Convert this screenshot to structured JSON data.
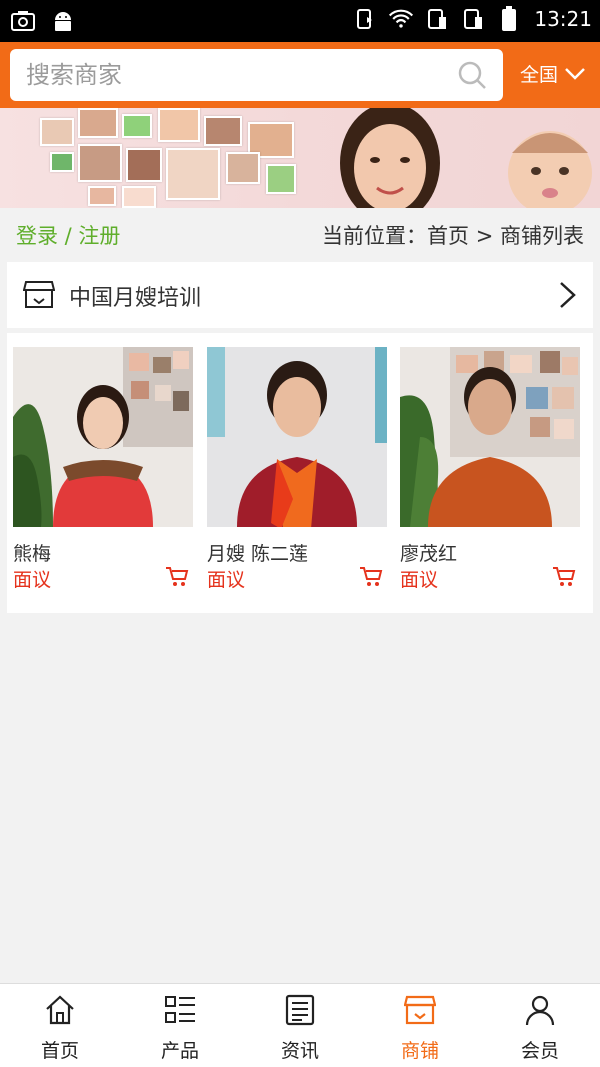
{
  "status_bar": {
    "time": "13:21"
  },
  "search": {
    "placeholder": "搜索商家",
    "region": "全国"
  },
  "breadcrumb": {
    "login": "登录 / 注册",
    "path": "当前位置：首页 > 商铺列表"
  },
  "shop": {
    "name": "中国月嫂培训"
  },
  "products": [
    {
      "name": "熊梅",
      "price": "面议"
    },
    {
      "name": "月嫂 陈二莲",
      "price": "面议"
    },
    {
      "name": "廖茂红",
      "price": "面议"
    }
  ],
  "tabs": [
    {
      "label": "首页",
      "icon": "home-icon"
    },
    {
      "label": "产品",
      "icon": "list-icon"
    },
    {
      "label": "资讯",
      "icon": "news-icon"
    },
    {
      "label": "商铺",
      "icon": "store-icon",
      "active": true
    },
    {
      "label": "会员",
      "icon": "user-icon"
    }
  ],
  "colors": {
    "accent": "#f26b17",
    "price": "#e5321c",
    "login": "#5fae2b"
  }
}
